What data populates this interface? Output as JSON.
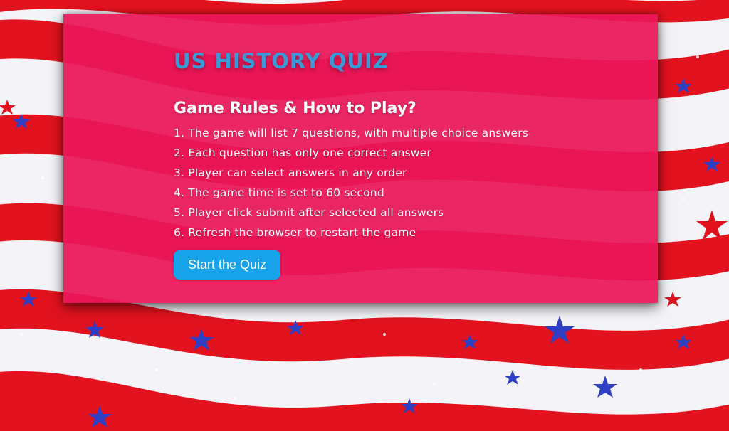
{
  "quiz": {
    "title": "US HISTORY QUIZ",
    "rules_heading": "Game Rules & How to Play?",
    "rules": [
      "1. The game will list 7 questions, with multiple choice answers",
      "2. Each question has only one correct answer",
      "3. Player can select answers in any order",
      "4. The game time is set to 60 second",
      "5. Player click submit after selected all answers",
      "6. Refresh the browser to restart the game"
    ],
    "start_button_label": "Start the Quiz"
  },
  "colors": {
    "card_background": "#ea1658",
    "title": "#3a9ad8",
    "button": "#16a3ea",
    "flag_red": "#e3121f",
    "flag_white": "#f4f4f8",
    "star_blue": "#2f3fc4"
  },
  "background": {
    "image": "waving-american-flag-stripes-and-stars"
  }
}
